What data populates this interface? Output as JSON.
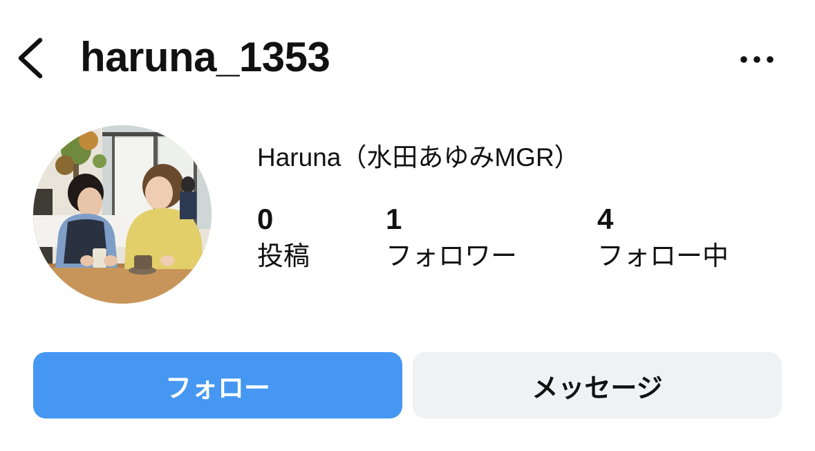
{
  "header": {
    "username": "haruna_1353",
    "back_icon": "chevron-left-icon",
    "more_icon": "more-horizontal-icon"
  },
  "profile": {
    "display_name": "Haruna（水田あゆみMGR）",
    "avatar_description_icon": "avatar"
  },
  "stats": {
    "posts": {
      "value": "0",
      "label": "投稿"
    },
    "followers": {
      "value": "1",
      "label": "フォロワー"
    },
    "following": {
      "value": "4",
      "label": "フォロー中"
    }
  },
  "actions": {
    "follow_label": "フォロー",
    "message_label": "メッセージ"
  },
  "colors": {
    "follow_button": "#4597f2",
    "message_button": "#eff1f3",
    "text": "#111111",
    "background": "#ffffff"
  }
}
